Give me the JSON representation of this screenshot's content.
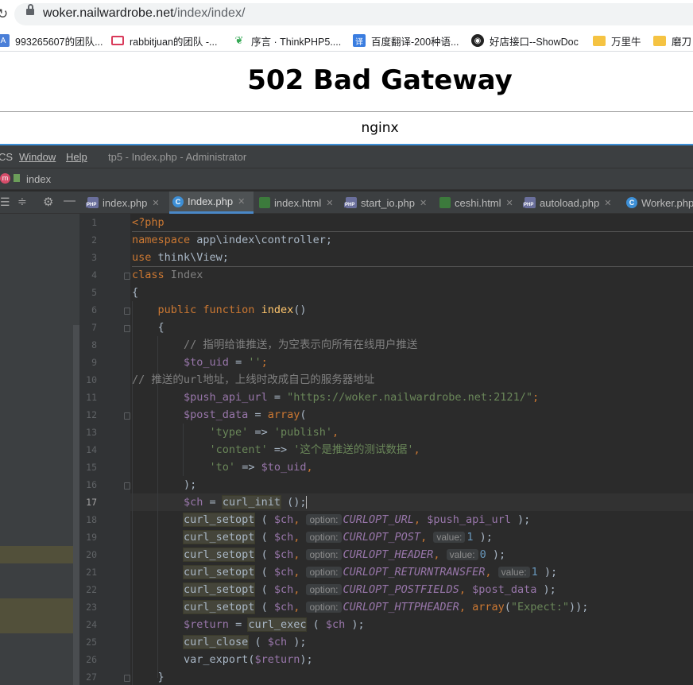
{
  "browser": {
    "url_host": "woker.nailwardrobe.net",
    "url_path": "/index/index/",
    "bookmarks": [
      {
        "label": "993265607的团队...",
        "icon": "blue-a-icon",
        "color": "#4a7fd8"
      },
      {
        "label": "rabbitjuan的团队 -...",
        "icon": "mail-icon",
        "color": "#d93a5a"
      },
      {
        "label": "序言 · ThinkPHP5....",
        "icon": "leaf-icon",
        "color": "#35a855"
      },
      {
        "label": "百度翻译-200种语...",
        "icon": "translate-icon",
        "color": "#3a7de0"
      },
      {
        "label": "好店接口--ShowDoc",
        "icon": "showdoc-icon",
        "color": "#222222"
      },
      {
        "label": "万里牛",
        "icon": "folder-icon",
        "color": "#f5c342"
      },
      {
        "label": "磨刀",
        "icon": "folder-icon",
        "color": "#f5c342"
      }
    ]
  },
  "page": {
    "heading": "502 Bad Gateway",
    "server": "nginx"
  },
  "ide": {
    "menu": [
      "CS",
      "Window",
      "Help"
    ],
    "window_title": "tp5 - Index.php - Administrator",
    "breadcrumb": "index",
    "tabs": [
      {
        "label": "index.php",
        "type": "php",
        "active": false
      },
      {
        "label": "Index.php",
        "type": "class",
        "active": true
      },
      {
        "label": "index.html",
        "type": "html",
        "active": false
      },
      {
        "label": "start_io.php",
        "type": "php",
        "active": false
      },
      {
        "label": "ceshi.html",
        "type": "html",
        "active": false
      },
      {
        "label": "autoload.php",
        "type": "php",
        "active": false
      },
      {
        "label": "Worker.php",
        "type": "class",
        "active": false
      }
    ],
    "current_line": 17,
    "line_numbers": [
      "1",
      "2",
      "3",
      "4",
      "5",
      "6",
      "7",
      "8",
      "9",
      "10",
      "11",
      "12",
      "13",
      "14",
      "15",
      "16",
      "17",
      "18",
      "19",
      "20",
      "21",
      "22",
      "23",
      "24",
      "25",
      "26",
      "27"
    ],
    "code": {
      "l1": "<?php",
      "l2_kw": "namespace",
      "l2_rest": " app\\index\\controller;",
      "l3_kw": "use",
      "l3_rest": " think\\View;",
      "l4_kw": "class",
      "l4_name": " Index",
      "l5": "{",
      "l6_kw": "public function",
      "l6_fn": "index",
      "l6_rest": "()",
      "l7": "{",
      "l8": "// 指明给谁推送，为空表示向所有在线用户推送",
      "l9_var": "$to_uid",
      "l9_op": " = ",
      "l9_str": "''",
      "l9_end": ";",
      "l10": "// 推送的url地址，上线时改成自己的服务器地址",
      "l11_var": "$push_api_url",
      "l11_op": " = ",
      "l11_str": "\"https://woker.nailwardrobe.net:2121/\"",
      "l11_end": ";",
      "l12_var": "$post_data",
      "l12_op": " = ",
      "l12_fn": "array",
      "l12_end": "(",
      "l13_key": "'type'",
      "l13_op": " => ",
      "l13_val": "'publish'",
      "l13_end": ",",
      "l14_key": "'content'",
      "l14_op": " => ",
      "l14_val": "'这个是推送的测试数据'",
      "l14_end": ",",
      "l15_key": "'to'",
      "l15_op": " => ",
      "l15_val": "$to_uid",
      "l15_end": ",",
      "l16": ");",
      "l17_var": "$ch",
      "l17_op": " = ",
      "l17_fn": "curl_init",
      "l17_end": " ();",
      "setopt": "curl_setopt",
      "open": " ( ",
      "ch": "$ch",
      "comma": ", ",
      "hint_option": "option:",
      "hint_value": "value:",
      "l18_const": "CURLOPT_URL",
      "l18_arg": "$push_api_url",
      "l18_end": " );",
      "l19_const": "CURLOPT_POST",
      "l19_val": "1",
      "l19_end": " );",
      "l20_const": "CURLOPT_HEADER",
      "l20_val": "0",
      "l20_end": " );",
      "l21_const": "CURLOPT_RETURNTRANSFER",
      "l21_val": "1",
      "l21_end": " );",
      "l22_const": "CURLOPT_POSTFIELDS",
      "l22_arg": "$post_data",
      "l22_end": " );",
      "l23_const": "CURLOPT_HTTPHEADER",
      "l23_fn": "array",
      "l23_str": "\"Expect:\"",
      "l23_end": "));",
      "l24_var": "$return",
      "l24_op": " = ",
      "l24_fn": "curl_exec",
      "l24_mid": " ( ",
      "l24_arg": "$ch",
      "l24_end": " );",
      "l25_fn": "curl_close",
      "l25_mid": " ( ",
      "l25_arg": "$ch",
      "l25_end": " );",
      "l26_fn": "var_export",
      "l26_open": "(",
      "l26_arg": "$return",
      "l26_end": ");",
      "l27": "}"
    }
  }
}
